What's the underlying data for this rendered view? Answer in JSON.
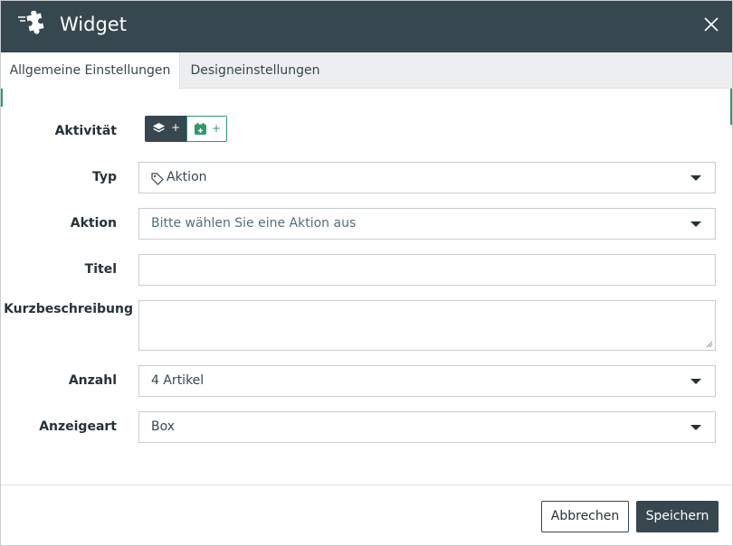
{
  "dialog": {
    "title": "Widget"
  },
  "tabs": [
    {
      "label": "Allgemeine Einstellungen",
      "active": true
    },
    {
      "label": "Designeinstellungen",
      "active": false
    }
  ],
  "form": {
    "aktivitaet_label": "Aktivität",
    "aktivitaet_btn1": "+",
    "aktivitaet_btn2": "+",
    "typ_label": "Typ",
    "typ_value": "Aktion",
    "aktion_label": "Aktion",
    "aktion_placeholder": "Bitte wählen Sie eine Aktion aus",
    "titel_label": "Titel",
    "titel_value": "",
    "kurz_label": "Kurzbeschreibung",
    "kurz_value": "",
    "anzahl_label": "Anzahl",
    "anzahl_value": "4 Artikel",
    "anzeige_label": "Anzeigeart",
    "anzeige_value": "Box"
  },
  "footer": {
    "cancel_label": "Abbrechen",
    "save_label": "Speichern"
  },
  "colors": {
    "header_bg": "#37474f",
    "accent_green": "#2e9a6a"
  }
}
